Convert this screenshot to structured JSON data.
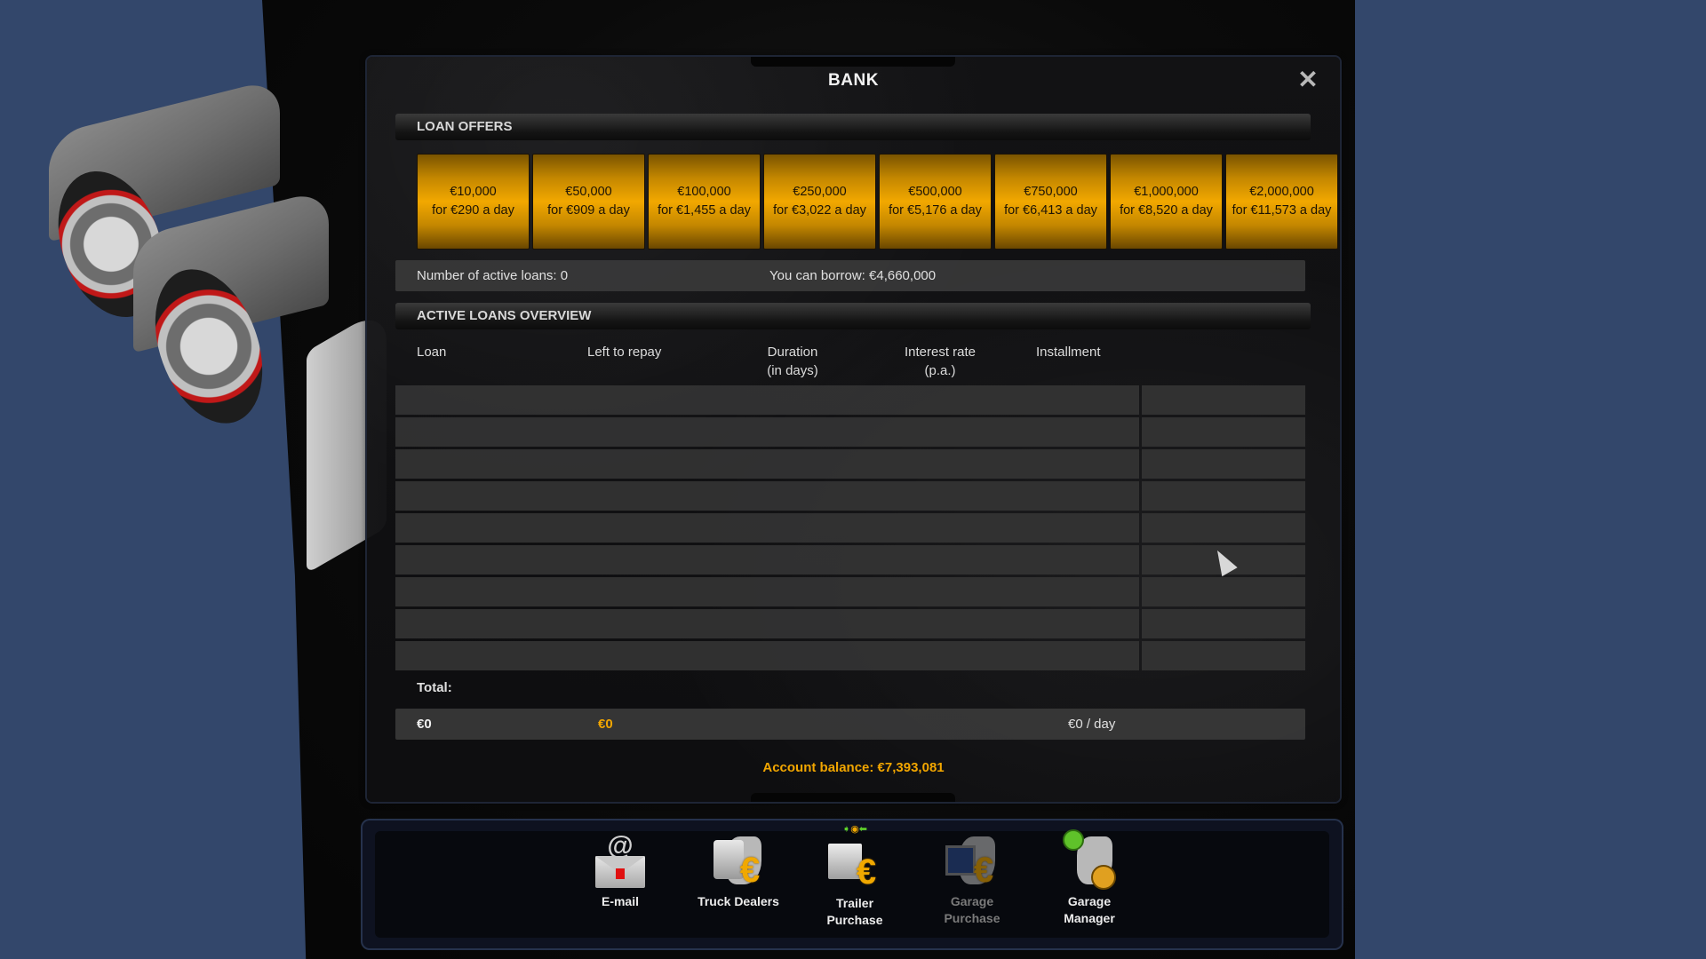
{
  "window": {
    "title": "BANK",
    "close_icon": "close-x-icon"
  },
  "loan_offers": {
    "header": "LOAN OFFERS",
    "offers": [
      {
        "amount": "€10,000",
        "rate": "for €290 a day"
      },
      {
        "amount": "€50,000",
        "rate": "for €909 a day"
      },
      {
        "amount": "€100,000",
        "rate": "for €1,455 a day"
      },
      {
        "amount": "€250,000",
        "rate": "for €3,022 a day"
      },
      {
        "amount": "€500,000",
        "rate": "for €5,176 a day"
      },
      {
        "amount": "€750,000",
        "rate": "for €6,413 a day"
      },
      {
        "amount": "€1,000,000",
        "rate": "for €8,520 a day"
      },
      {
        "amount": "€2,000,000",
        "rate": "for €11,573 a day"
      }
    ]
  },
  "info": {
    "active_loans": "Number of active loans: 0",
    "can_borrow": "You can borrow: €4,660,000"
  },
  "active_loans": {
    "header": "ACTIVE LOANS OVERVIEW",
    "columns": [
      {
        "line1": "Loan",
        "line2": ""
      },
      {
        "line1": "Left to repay",
        "line2": ""
      },
      {
        "line1": "Duration",
        "line2": "(in days)"
      },
      {
        "line1": "Interest rate",
        "line2": "(p.a.)"
      },
      {
        "line1": "Installment",
        "line2": ""
      }
    ],
    "row_count": 9,
    "total_label": "Total:",
    "totals": {
      "loan": "€0",
      "left_to_repay": "€0",
      "installment": "€0 / day"
    }
  },
  "account_balance": "Account balance: €7,393,081",
  "colors": {
    "accent": "#f2a600",
    "offer_button": "#f2a800",
    "background": "#33476b"
  },
  "toolbar": {
    "items": [
      {
        "label1": "E-mail",
        "label2": "",
        "icon": "email-icon",
        "enabled": true
      },
      {
        "label1": "Truck Dealers",
        "label2": "",
        "icon": "truck-dealers-icon",
        "enabled": true
      },
      {
        "label1": "Trailer",
        "label2": "Purchase",
        "icon": "trailer-purchase-icon",
        "enabled": true
      },
      {
        "label1": "Garage",
        "label2": "Purchase",
        "icon": "garage-purchase-icon",
        "enabled": false
      },
      {
        "label1": "Garage",
        "label2": "Manager",
        "icon": "garage-manager-icon",
        "enabled": true
      }
    ]
  }
}
